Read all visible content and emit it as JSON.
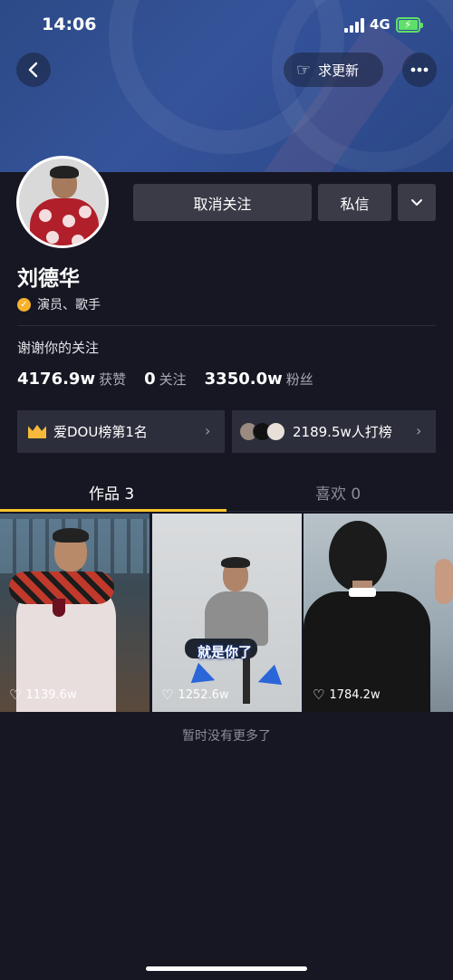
{
  "status_bar": {
    "time": "14:06",
    "network": "4G"
  },
  "header": {
    "back_icon": "chevron-left-icon",
    "request_update_label": "求更新",
    "more_icon": "more-dots-icon"
  },
  "profile": {
    "name": "刘德华",
    "verification": "演员、歌手",
    "signature": "谢谢你的关注",
    "unfollow_label": "取消关注",
    "message_label": "私信",
    "stats": [
      {
        "value": "4176.9w",
        "label": "获赞"
      },
      {
        "value": "0",
        "label": "关注"
      },
      {
        "value": "3350.0w",
        "label": "粉丝"
      }
    ],
    "rank": {
      "label": "爱DOU榜第1名"
    },
    "supporters": {
      "label": "2189.5w人打榜"
    }
  },
  "tabs": [
    {
      "label": "作品 3",
      "active": true
    },
    {
      "label": "喜欢 0",
      "active": false
    }
  ],
  "videos": [
    {
      "likes": "1139.6w"
    },
    {
      "likes": "1252.6w",
      "caption": "就是你了"
    },
    {
      "likes": "1784.2w"
    }
  ],
  "end_text": "暂时没有更多了",
  "colors": {
    "accent": "#f7c62c",
    "background": "#161723",
    "verify": "#f7b22c"
  }
}
